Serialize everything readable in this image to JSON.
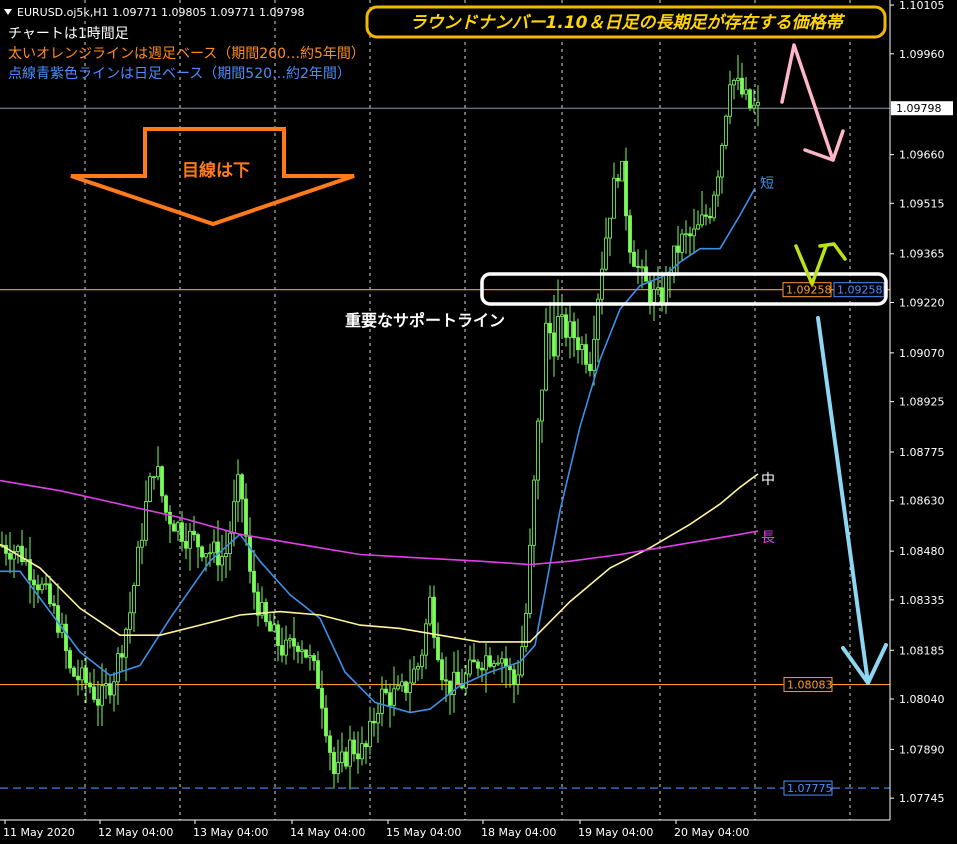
{
  "chart_data": {
    "type": "candlestick",
    "symbol_header": "EURUSD.oj5k,H1  1.09771 1.09805 1.09771 1.09798",
    "info_lines": [
      {
        "text": "チャートは1時間足",
        "color": "#ffffff"
      },
      {
        "text": "太いオレンジラインは週足ベース（期間260…約5年間）",
        "color": "#ff8c1a"
      },
      {
        "text": "点線青紫色ラインは日足ベース（期間520…約2年間）",
        "color": "#4d8cff"
      }
    ],
    "banner": "ラウンドナンバー1.10＆日足の長期足が存在する価格帯",
    "arrow_label": "目線は下",
    "support_label": "重要なサポートライン",
    "ma_labels": {
      "short": "短",
      "mid": "中",
      "long": "長"
    },
    "price_axis": {
      "min": 1.0768,
      "max": 1.1012,
      "ticks": [
        "1.10105",
        "1.09960",
        "1.09660",
        "1.09515",
        "1.09365",
        "1.09220",
        "1.09070",
        "1.08925",
        "1.08775",
        "1.08630",
        "1.08480",
        "1.08335",
        "1.08185",
        "1.08040",
        "1.07890",
        "1.07745"
      ]
    },
    "time_axis": [
      "11 May 2020",
      "12 May 04:00",
      "13 May 04:00",
      "14 May 04:00",
      "15 May 04:00",
      "18 May 04:00",
      "19 May 04:00",
      "20 May 04:00"
    ],
    "current_price": "1.09798",
    "levels": [
      {
        "price": 1.09258,
        "label": "1.09258",
        "label2": "1.09258",
        "color": "#ff9a2e",
        "style": "solid"
      },
      {
        "price": 1.08083,
        "label": "1.08083",
        "color": "#ff9a2e",
        "style": "solid"
      },
      {
        "price": 1.07775,
        "label": "1.07775",
        "color": "#4d8cff",
        "style": "dashed"
      }
    ],
    "series": [
      {
        "name": "短",
        "color": "#3d8fe8",
        "values": [
          [
            0,
            1.0842
          ],
          [
            20,
            1.0842
          ],
          [
            50,
            1.083
          ],
          [
            80,
            1.0818
          ],
          [
            110,
            1.0811
          ],
          [
            140,
            1.0814
          ],
          [
            170,
            1.0828
          ],
          [
            210,
            1.0845
          ],
          [
            240,
            1.0853
          ],
          [
            260,
            1.0845
          ],
          [
            290,
            1.0835
          ],
          [
            320,
            1.0828
          ],
          [
            345,
            1.0812
          ],
          [
            375,
            1.0803
          ],
          [
            410,
            1.08
          ],
          [
            430,
            1.0801
          ],
          [
            460,
            1.0808
          ],
          [
            490,
            1.0812
          ],
          [
            520,
            1.0815
          ],
          [
            535,
            1.082
          ],
          [
            560,
            1.086
          ],
          [
            580,
            1.0885
          ],
          [
            600,
            1.0905
          ],
          [
            620,
            1.092
          ],
          [
            640,
            1.0927
          ],
          [
            665,
            1.093
          ],
          [
            680,
            1.0934
          ],
          [
            700,
            1.0938
          ],
          [
            720,
            1.0938
          ],
          [
            740,
            1.0948
          ],
          [
            755,
            1.0956
          ]
        ]
      },
      {
        "name": "中",
        "color": "#fff49a",
        "values": [
          [
            0,
            1.085
          ],
          [
            40,
            1.0843
          ],
          [
            80,
            1.0831
          ],
          [
            120,
            1.0823
          ],
          [
            160,
            1.0823
          ],
          [
            200,
            1.0826
          ],
          [
            240,
            1.0829
          ],
          [
            280,
            1.083
          ],
          [
            320,
            1.0829
          ],
          [
            360,
            1.0826
          ],
          [
            400,
            1.0825
          ],
          [
            440,
            1.0823
          ],
          [
            480,
            1.0821
          ],
          [
            530,
            1.0821
          ],
          [
            570,
            1.0833
          ],
          [
            610,
            1.0843
          ],
          [
            650,
            1.0849
          ],
          [
            690,
            1.0856
          ],
          [
            720,
            1.0862
          ],
          [
            740,
            1.0867
          ],
          [
            758,
            1.0871
          ]
        ]
      },
      {
        "name": "長",
        "color": "#e040e8",
        "values": [
          [
            0,
            1.0869
          ],
          [
            60,
            1.0866
          ],
          [
            120,
            1.0862
          ],
          [
            180,
            1.0858
          ],
          [
            240,
            1.0853
          ],
          [
            300,
            1.085
          ],
          [
            360,
            1.0847
          ],
          [
            420,
            1.0846
          ],
          [
            480,
            1.0845
          ],
          [
            530,
            1.0844
          ],
          [
            570,
            1.0845
          ],
          [
            620,
            1.0847
          ],
          [
            660,
            1.0849
          ],
          [
            700,
            1.0851
          ],
          [
            740,
            1.0853
          ],
          [
            758,
            1.0854
          ]
        ]
      }
    ],
    "price_path": [
      [
        0,
        1.085
      ],
      [
        20,
        1.0848
      ],
      [
        40,
        1.0838
      ],
      [
        60,
        1.0826
      ],
      [
        70,
        1.0812
      ],
      [
        90,
        1.0808
      ],
      [
        100,
        1.0803
      ],
      [
        115,
        1.0812
      ],
      [
        130,
        1.083
      ],
      [
        145,
        1.086
      ],
      [
        155,
        1.0875
      ],
      [
        165,
        1.086
      ],
      [
        185,
        1.0853
      ],
      [
        210,
        1.0848
      ],
      [
        225,
        1.0846
      ],
      [
        240,
        1.087
      ],
      [
        250,
        1.084
      ],
      [
        265,
        1.0826
      ],
      [
        285,
        1.0818
      ],
      [
        300,
        1.0822
      ],
      [
        320,
        1.0808
      ],
      [
        335,
        1.078
      ],
      [
        350,
        1.079
      ],
      [
        365,
        1.0788
      ],
      [
        380,
        1.0805
      ],
      [
        400,
        1.0805
      ],
      [
        420,
        1.0815
      ],
      [
        430,
        1.0833
      ],
      [
        445,
        1.0808
      ],
      [
        460,
        1.0808
      ],
      [
        480,
        1.0816
      ],
      [
        500,
        1.0818
      ],
      [
        515,
        1.0808
      ],
      [
        525,
        1.0825
      ],
      [
        535,
        1.087
      ],
      [
        545,
        1.0912
      ],
      [
        560,
        1.0915
      ],
      [
        575,
        1.0912
      ],
      [
        590,
        1.0905
      ],
      [
        600,
        1.093
      ],
      [
        610,
        1.095
      ],
      [
        620,
        1.0965
      ],
      [
        630,
        1.094
      ],
      [
        640,
        1.093
      ],
      [
        650,
        1.0925
      ],
      [
        660,
        1.0922
      ],
      [
        670,
        1.0932
      ],
      [
        680,
        1.094
      ],
      [
        695,
        1.0942
      ],
      [
        710,
        1.095
      ],
      [
        720,
        1.0965
      ],
      [
        730,
        1.099
      ],
      [
        740,
        1.0985
      ],
      [
        750,
        1.098
      ],
      [
        760,
        1.0979
      ]
    ]
  }
}
